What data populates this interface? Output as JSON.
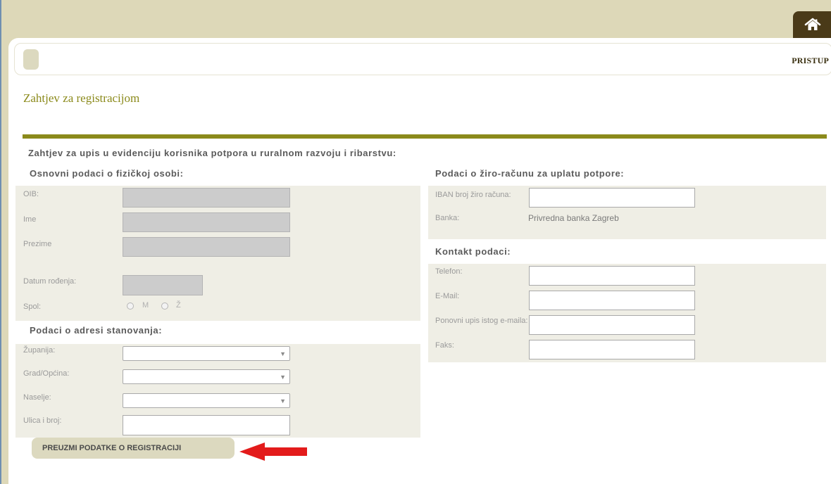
{
  "header": {
    "home_icon": "home-icon",
    "nav_link": "PRISTUP"
  },
  "page": {
    "title": "Zahtjev za registracijom",
    "form_heading": "Zahtjev za upis u evidenciju korisnika potpora u ruralnom razvoju i ribarstvu:"
  },
  "personal": {
    "heading": "Osnovni podaci o fizičkoj osobi:",
    "oib_label": "OIB:",
    "oib_value": "",
    "ime_label": "Ime",
    "ime_value": "",
    "prezime_label": "Prezime",
    "prezime_value": "",
    "datum_label": "Datum rođenja:",
    "datum_value": "",
    "spol_label": "Spol:",
    "spol_options": [
      "M",
      "Ž"
    ]
  },
  "address": {
    "heading": "Podaci o adresi stanovanja:",
    "zupanija_label": "Županija:",
    "zupanija_value": "",
    "grad_label": "Grad/Općina:",
    "grad_value": "",
    "naselje_label": "Naselje:",
    "naselje_value": "",
    "ulica_label": "Ulica i broj:",
    "ulica_value": ""
  },
  "bank": {
    "heading": "Podaci o žiro-računu za uplatu potpore:",
    "iban_label": "IBAN broj žiro računa:",
    "iban_value": "",
    "banka_label": "Banka:",
    "banka_value": "Privredna banka Zagreb"
  },
  "contact": {
    "heading": "Kontakt podaci:",
    "telefon_label": "Telefon:",
    "telefon_value": "",
    "email_label": "E-Mail:",
    "email_value": "",
    "email_repeat_label": "Ponovni upis istog e-maila:",
    "email_repeat_value": "",
    "faks_label": "Faks:",
    "faks_value": ""
  },
  "actions": {
    "download_label": "PREUZMI PODATKE O REGISTRACIJI"
  },
  "colors": {
    "accent_olive": "#8b8a1b",
    "header_band": "#ddd8b8",
    "home_tab": "#4a3a18",
    "panel_bg": "#efeee5",
    "arrow_red": "#e31b1b"
  }
}
